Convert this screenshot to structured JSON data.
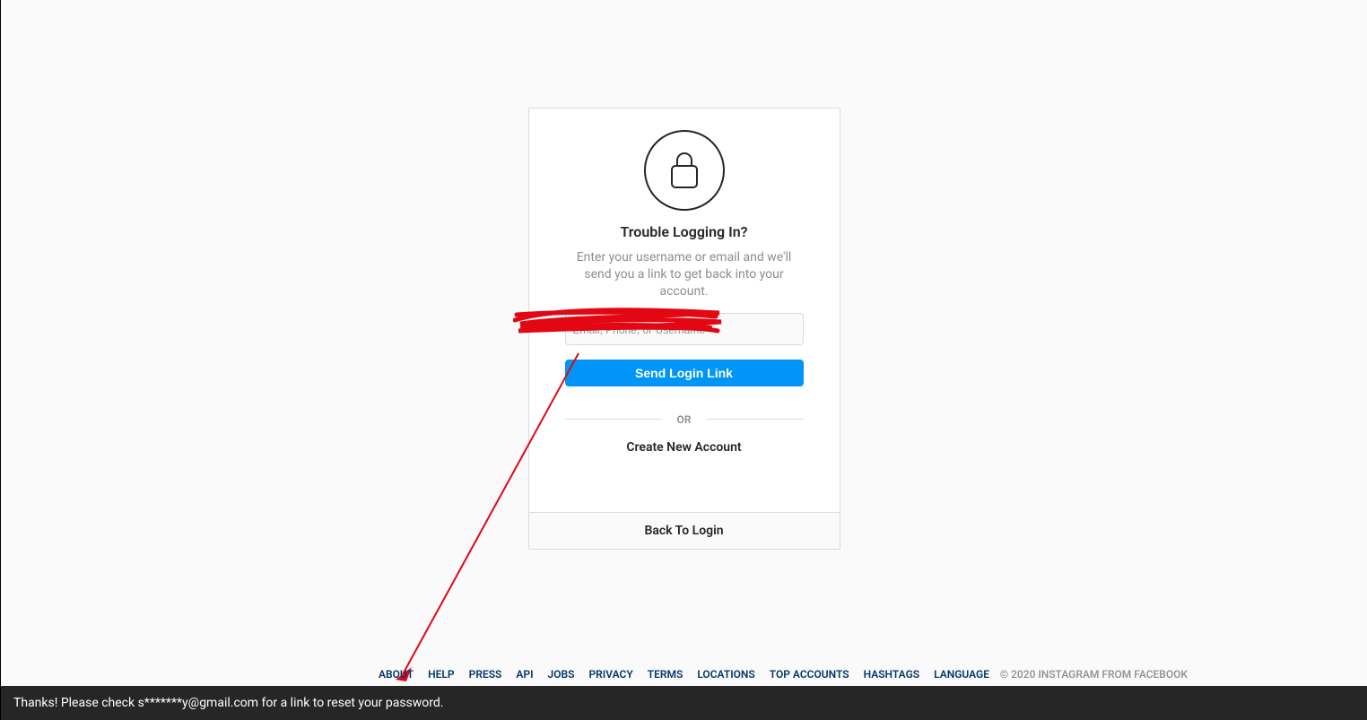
{
  "card": {
    "title": "Trouble Logging In?",
    "subtitle": "Enter your username or email and we'll send you a link to get back into your account.",
    "input_placeholder": "Email, Phone, or Username",
    "send_button": "Send Login Link",
    "or": "OR",
    "create_account": "Create New Account",
    "back_to_login": "Back To Login"
  },
  "footer": {
    "links": [
      "ABOUT",
      "HELP",
      "PRESS",
      "API",
      "JOBS",
      "PRIVACY",
      "TERMS",
      "LOCATIONS",
      "TOP ACCOUNTS",
      "HASHTAGS",
      "LANGUAGE"
    ],
    "copyright": "© 2020 INSTAGRAM FROM FACEBOOK"
  },
  "toast": {
    "message": "Thanks! Please check s*******y@gmail.com for a link to reset your password."
  }
}
